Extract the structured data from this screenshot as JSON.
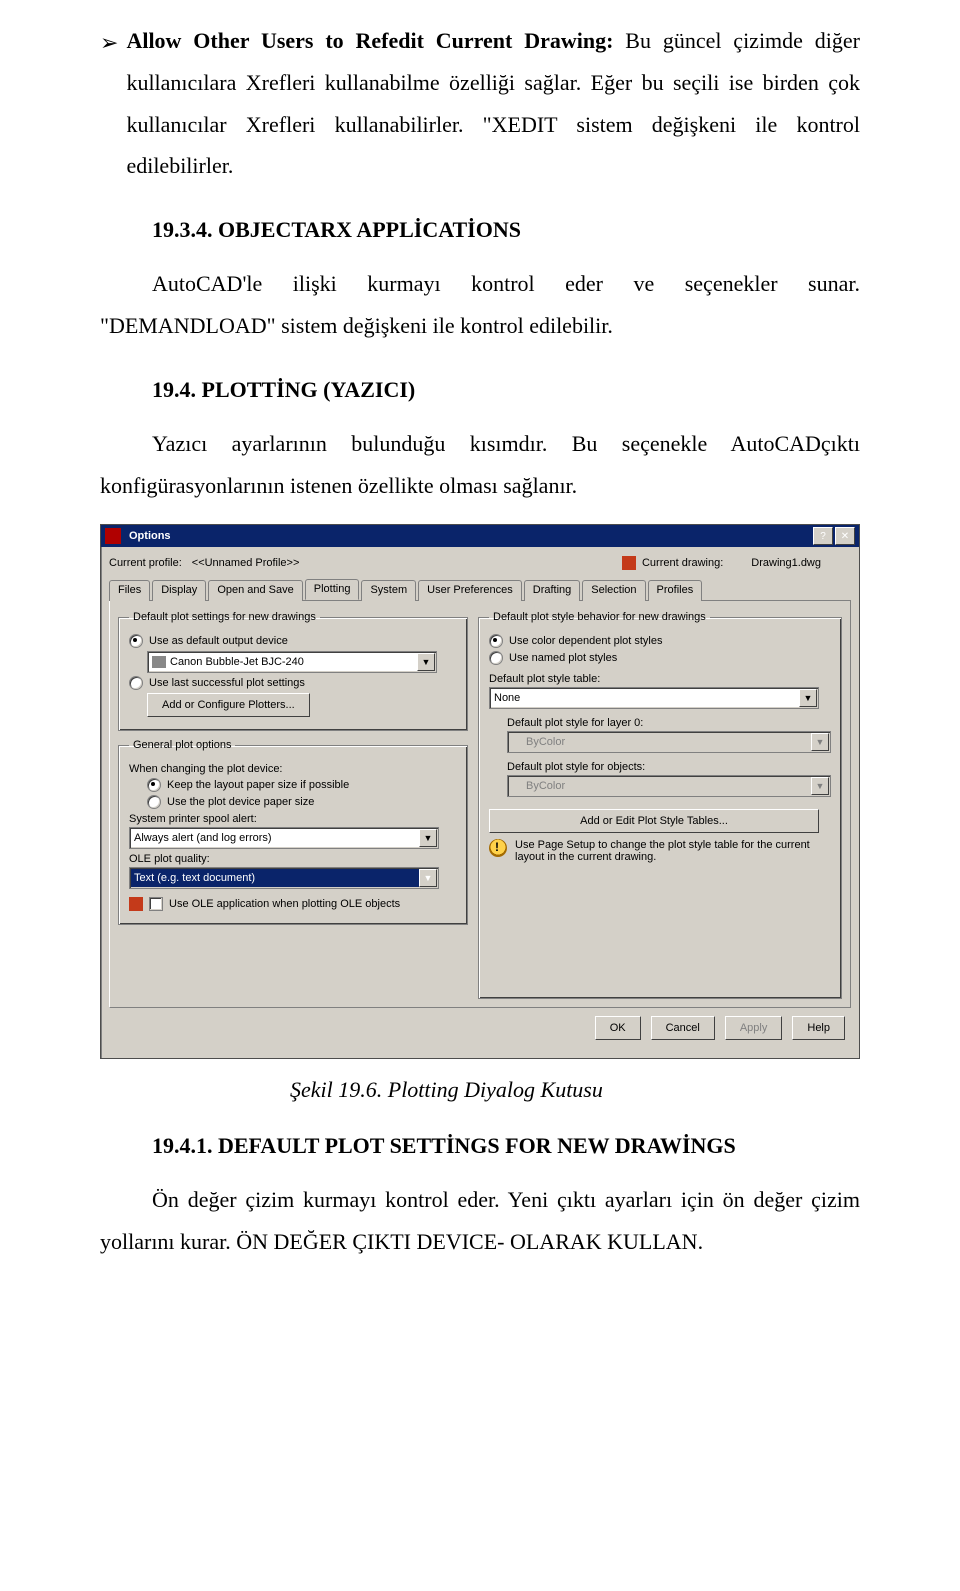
{
  "doc": {
    "bullet_arrow": "➢",
    "bullet_title": "Allow Other Users to Refedit Current Drawing:",
    "p1_rest": " Bu güncel çizimde diğer kullanıcılara Xrefleri kullanabilme özelliği sağlar. Eğer bu seçili ise birden çok kullanıcılar Xrefleri kullanabilirler. \"XEDIT sistem değişkeni ile kontrol edilebilirler.",
    "h_1934": "19.3.4. OBJECTARX APPLİCATİONS",
    "p2": "AutoCAD'le ilişki kurmayı kontrol eder ve seçenekler sunar. \"DEMANDLOAD\" sistem değişkeni ile kontrol edilebilir.",
    "h_194": "19.4. PLOTTİNG (YAZICI)",
    "p3": "Yazıcı ayarlarının bulunduğu kısımdır. Bu seçenekle AutoCADçıktı konfigürasyonlarının istenen özellikte olması sağlanır.",
    "caption": "Şekil 19.6. Plotting Diyalog Kutusu",
    "h_1941": "19.4.1. DEFAULT PLOT SETTİNGS FOR NEW DRAWİNGS",
    "p4": "Ön değer çizim kurmayı kontrol eder. Yeni çıktı ayarları için ön değer çizim yollarını kurar. ÖN DEĞER ÇIKTI DEVICE- OLARAK KULLAN."
  },
  "dlg": {
    "title": "Options",
    "profile_label": "Current profile:",
    "profile_value": "<<Unnamed Profile>>",
    "drawing_label": "Current drawing:",
    "drawing_value": "Drawing1.dwg",
    "tabs": [
      "Files",
      "Display",
      "Open and Save",
      "Plotting",
      "System",
      "User Preferences",
      "Drafting",
      "Selection",
      "Profiles"
    ],
    "grp_default_plot": "Default plot settings for new drawings",
    "opt_use_default": "Use as default output device",
    "dd_printer": "Canon Bubble-Jet BJC-240",
    "opt_use_last": "Use last successful plot settings",
    "btn_add_plotters": "Add or Configure Plotters...",
    "grp_general": "General plot options",
    "lbl_when_changing": "When changing the plot device:",
    "opt_keep_layout": "Keep the layout paper size if possible",
    "opt_use_paper": "Use the plot device paper size",
    "lbl_spool": "System printer spool alert:",
    "dd_spool": "Always alert (and log errors)",
    "lbl_ole": "OLE plot quality:",
    "dd_ole": "Text (e.g. text document)",
    "chk_ole_app": "Use OLE application when plotting OLE objects",
    "grp_style_behavior": "Default plot style behavior for new drawings",
    "opt_color_dep": "Use color dependent plot styles",
    "opt_named": "Use named plot styles",
    "lbl_style_table": "Default plot style table:",
    "dd_style_table": "None",
    "lbl_style_layer0": "Default plot style for layer 0:",
    "dd_style_layer0": "ByColor",
    "lbl_style_objects": "Default plot style for objects:",
    "dd_style_objects": "ByColor",
    "btn_style_tables": "Add or Edit Plot Style Tables...",
    "tip": "Use Page Setup to change the plot style table for the current layout in the current drawing.",
    "btn_ok": "OK",
    "btn_cancel": "Cancel",
    "btn_apply": "Apply",
    "btn_help": "Help"
  }
}
